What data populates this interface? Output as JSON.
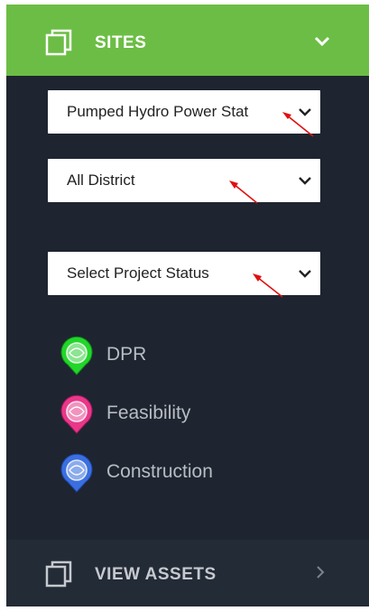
{
  "sidebar": {
    "sites_section": {
      "title": "SITES",
      "icon": "copy-icon",
      "expand_icon": "chevron-down-icon",
      "accent_color": "#6cbd45"
    },
    "filters": [
      {
        "selected": "Pumped Hydro Power Stat"
      },
      {
        "selected": "All District"
      },
      {
        "selected": "Select Project Status"
      }
    ],
    "legend": [
      {
        "label": "DPR",
        "color": "#22d62a"
      },
      {
        "label": "Feasibility",
        "color": "#e8388a"
      },
      {
        "label": "Construction",
        "color": "#3b6fe0"
      }
    ],
    "assets_section": {
      "title": "VIEW ASSETS",
      "icon": "copy-icon",
      "expand_icon": "chevron-right-icon"
    }
  }
}
